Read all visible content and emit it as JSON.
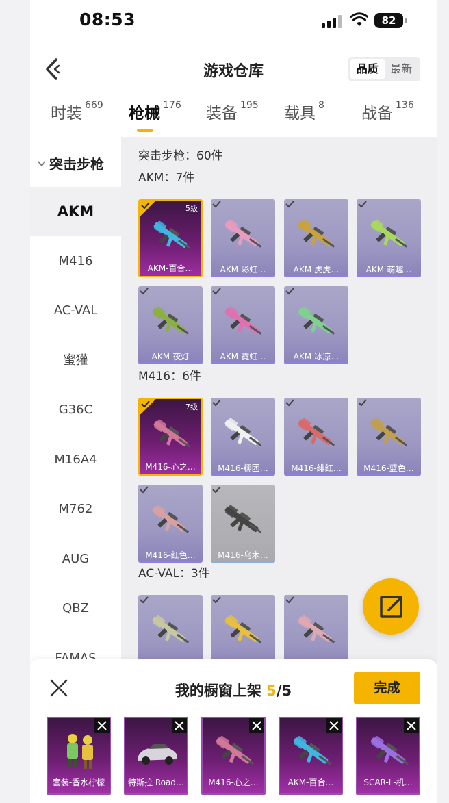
{
  "status_bar": {
    "time": "08:53",
    "battery": "82"
  },
  "header": {
    "title": "游戏仓库",
    "sort": {
      "quality": "品质",
      "latest": "最新",
      "active": "quality"
    }
  },
  "tabs": [
    {
      "label": "时装",
      "count": "669"
    },
    {
      "label": "枪械",
      "count": "176",
      "active": true
    },
    {
      "label": "装备",
      "count": "195"
    },
    {
      "label": "载具",
      "count": "8"
    },
    {
      "label": "战备",
      "count": "136"
    }
  ],
  "sidebar": {
    "group": "突击步枪",
    "items": [
      "AKM",
      "M416",
      "AC-VAL",
      "蜜獾",
      "G36C",
      "M16A4",
      "M762",
      "AUG",
      "QBZ",
      "FAMAS"
    ],
    "active": "AKM"
  },
  "main": {
    "summary": "突击步枪：60件",
    "sections": [
      {
        "title": "AKM：7件",
        "items": [
          {
            "name": "AKM-百合…",
            "level": "5级",
            "selected": true,
            "color": "#3fb6e0"
          },
          {
            "name": "AKM-彩虹…",
            "color": "#e89ac0"
          },
          {
            "name": "AKM-虎虎…",
            "color": "#c8a23c"
          },
          {
            "name": "AKM-萌趣…",
            "color": "#a8d860"
          },
          {
            "name": "AKM-夜灯",
            "color": "#8ab040"
          },
          {
            "name": "AKM-霓虹…",
            "color": "#e070b0"
          },
          {
            "name": "AKM-冰凉…",
            "color": "#80d090"
          }
        ]
      },
      {
        "title": "M416：6件",
        "items": [
          {
            "name": "M416-心之…",
            "level": "7级",
            "selected": true,
            "color": "#d07898"
          },
          {
            "name": "M416-糯团…",
            "color": "#f0f0f0"
          },
          {
            "name": "M416-绯红…",
            "color": "#d86a6a"
          },
          {
            "name": "M416-蓝色…",
            "color": "#c0a050"
          },
          {
            "name": "M416-红色…",
            "color": "#d8a0a0"
          },
          {
            "name": "M416-乌木…",
            "color": "#444444",
            "gray": true
          }
        ]
      },
      {
        "title": "AC-VAL：3件",
        "items": [
          {
            "name": "",
            "color": "#c8c8a0"
          },
          {
            "name": "",
            "color": "#e8c040"
          },
          {
            "name": "",
            "color": "#e0a8b0"
          }
        ]
      }
    ]
  },
  "showcase": {
    "title": "我的橱窗上架",
    "count": "5",
    "total": "/5",
    "done_label": "完成",
    "items": [
      {
        "name": "套装-香水柠檬",
        "type": "outfit"
      },
      {
        "name": "特斯拉 Road…",
        "type": "car"
      },
      {
        "name": "M416-心之…",
        "type": "gun",
        "color": "#d07898"
      },
      {
        "name": "AKM-百合…",
        "type": "gun",
        "color": "#3fb6e0"
      },
      {
        "name": "SCAR-L-机…",
        "type": "gun",
        "color": "#9a70e0"
      }
    ]
  }
}
